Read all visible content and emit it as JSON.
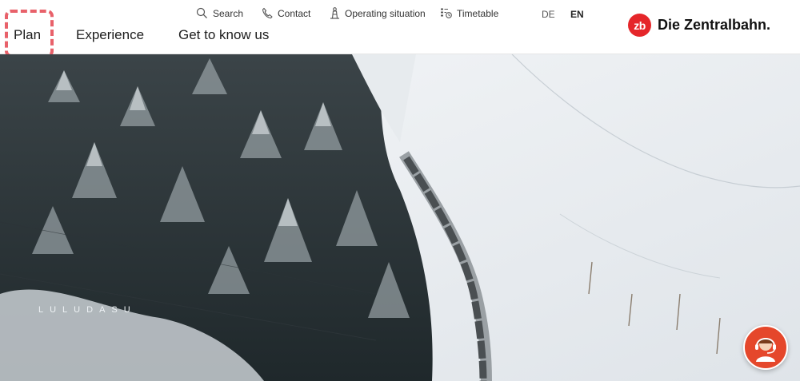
{
  "main_nav": [
    {
      "label": "Plan"
    },
    {
      "label": "Experience"
    },
    {
      "label": "Get to know us"
    }
  ],
  "utility_nav": {
    "search": "Search",
    "contact": "Contact",
    "operating": "Operating situation",
    "timetable": "Timetable"
  },
  "languages": {
    "de": "DE",
    "en": "EN",
    "active": "EN"
  },
  "logo": {
    "mark": "zb",
    "text": "Die Zentralbahn."
  },
  "hero": {
    "caption": "LULUDASU"
  },
  "colors": {
    "brand": "#e5262a",
    "chat": "#e5472b",
    "focus": "#e8616a"
  },
  "icons": {
    "search": "search-icon",
    "contact": "phone-icon",
    "operating": "signal-mast-icon",
    "timetable": "timetable-icon",
    "chat": "support-agent-icon"
  }
}
